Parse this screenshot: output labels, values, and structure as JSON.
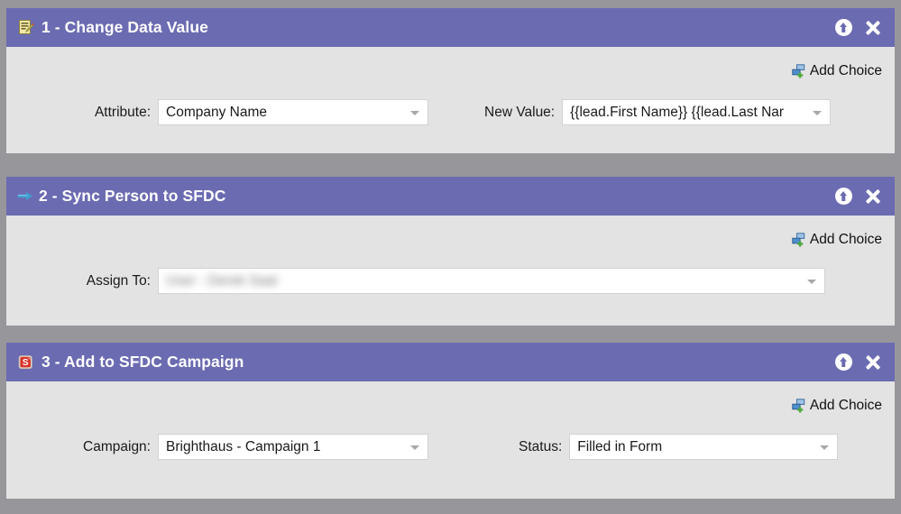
{
  "theme": {
    "header_purple": "#6b6bb2",
    "panel_body": "#e3e3e3",
    "page_background": "#97979b",
    "field_background": "#ffffff",
    "title_text": "#ffffff"
  },
  "panels": [
    {
      "icon": "change-data-value-icon",
      "title": "1 - Change Data Value",
      "collapse_label": "Collapse step",
      "close_label": "Remove step",
      "add_choice": {
        "icon": "add-choice-icon",
        "label": "Add Choice"
      },
      "fields": [
        {
          "label": "Attribute:",
          "value": "Company Name",
          "name": "attribute-select"
        },
        {
          "label": "New Value:",
          "value": "{{lead.First Name}} {{lead.Last Nar",
          "name": "new-value-select"
        }
      ]
    },
    {
      "icon": "sync-person-icon",
      "title": "2 - Sync Person to SFDC",
      "collapse_label": "Collapse step",
      "close_label": "Remove step",
      "add_choice": {
        "icon": "add-choice-icon",
        "label": "Add Choice"
      },
      "fields": [
        {
          "label": "Assign To:",
          "value": "User - Derek Saal",
          "name": "assign-to-select",
          "redacted": true
        }
      ]
    },
    {
      "icon": "sfdc-campaign-icon",
      "title": "3 - Add to SFDC Campaign",
      "collapse_label": "Collapse step",
      "close_label": "Remove step",
      "add_choice": {
        "icon": "add-choice-icon",
        "label": "Add Choice"
      },
      "fields": [
        {
          "label": "Campaign:",
          "value": "Brighthaus - Campaign 1",
          "name": "campaign-select"
        },
        {
          "label": "Status:",
          "value": "Filled in Form",
          "name": "status-select"
        }
      ]
    }
  ]
}
